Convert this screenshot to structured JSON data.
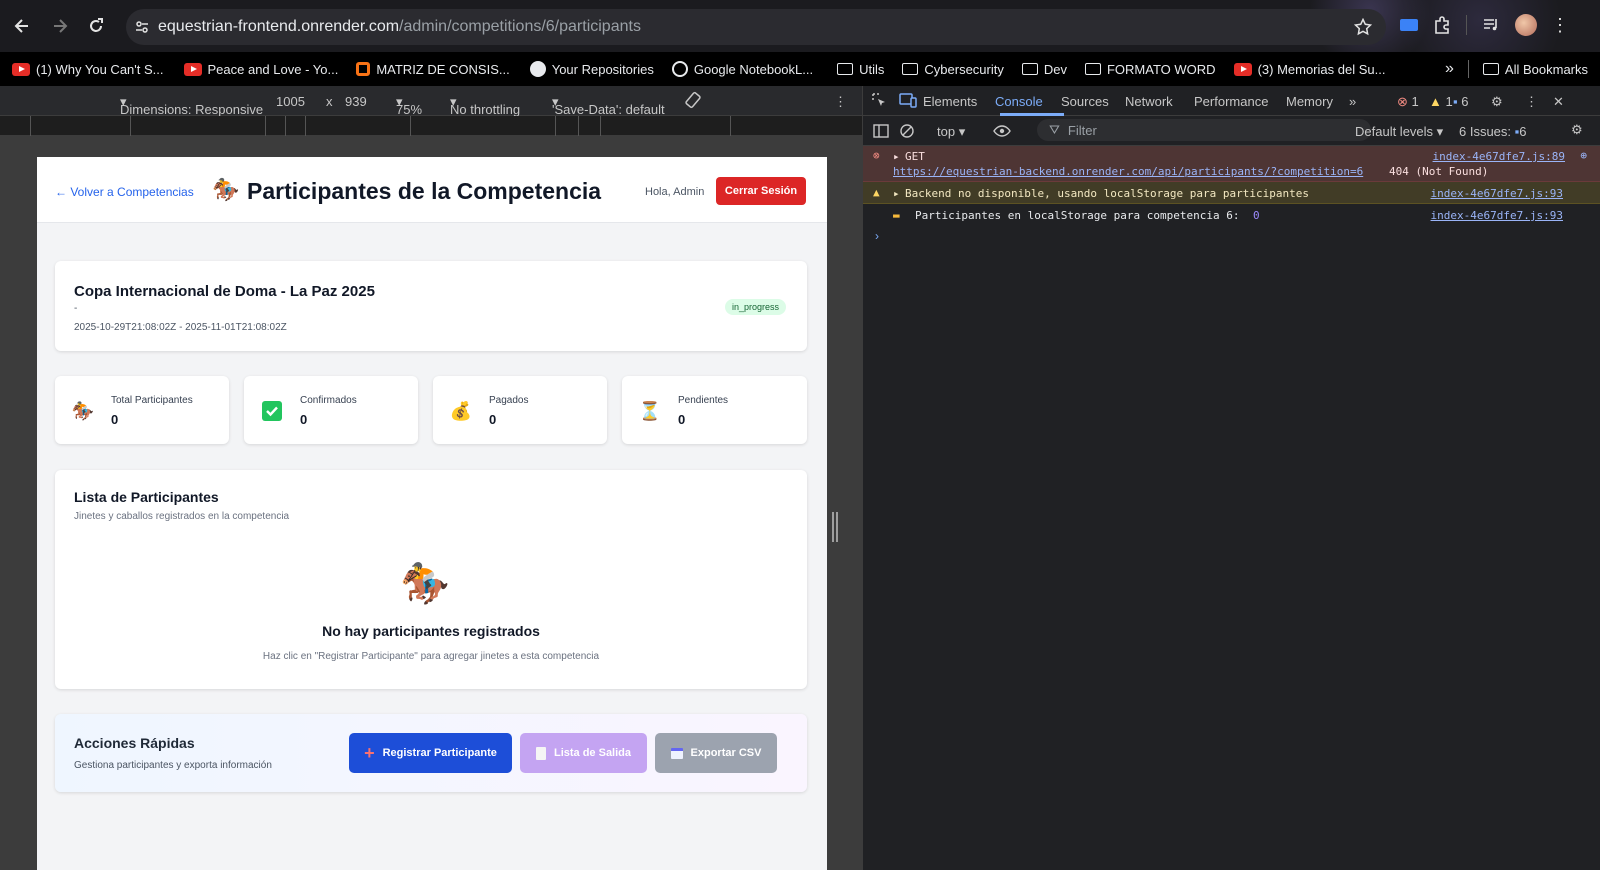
{
  "browser": {
    "url_host": "equestrian-frontend.onrender.com",
    "url_path": "/admin/competitions/6/participants",
    "bookmarks": [
      {
        "label": "(1) Why You Can't S...",
        "icon": "youtube-icon"
      },
      {
        "label": "Peace and Love - Yo...",
        "icon": "youtube-icon"
      },
      {
        "label": "MATRIZ DE CONSIS...",
        "icon": "app-icon"
      },
      {
        "label": "Your Repositories",
        "icon": "github-icon"
      },
      {
        "label": "Google NotebookL...",
        "icon": "notebooklm-icon"
      },
      {
        "label": "Utils",
        "icon": "folder-icon"
      },
      {
        "label": "Cybersecurity",
        "icon": "folder-icon"
      },
      {
        "label": "Dev",
        "icon": "folder-icon"
      },
      {
        "label": "FORMATO WORD",
        "icon": "folder-icon"
      },
      {
        "label": "(3) Memorias del Su...",
        "icon": "youtube-icon"
      }
    ],
    "all_bookmarks": "All Bookmarks"
  },
  "device_toolbar": {
    "dimensions": "Dimensions: Responsive",
    "width": "1005",
    "x": "x",
    "height": "939",
    "zoom": "75%",
    "throttling": "No throttling",
    "save_data": "'Save-Data': default"
  },
  "app": {
    "back_link": "← Volver a Competencias",
    "title": "Participantes de la Competencia",
    "greeting": "Hola, Admin",
    "logout": "Cerrar Sesión",
    "competition": {
      "name": "Copa Internacional de Doma - La Paz 2025",
      "location": "-",
      "dates": "2025-10-29T21:08:02Z - 2025-11-01T21:08:02Z",
      "status": "in_progress"
    },
    "stats": [
      {
        "label": "Total Participantes",
        "value": "0",
        "icon": "horse-racing-icon"
      },
      {
        "label": "Confirmados",
        "value": "0",
        "icon": "check-icon"
      },
      {
        "label": "Pagados",
        "value": "0",
        "icon": "money-bag-icon"
      },
      {
        "label": "Pendientes",
        "value": "0",
        "icon": "hourglass-icon"
      }
    ],
    "list": {
      "title": "Lista de Participantes",
      "subtitle": "Jinetes y caballos registrados en la competencia",
      "empty_title": "No hay participantes registrados",
      "empty_hint": "Haz clic en \"Registrar Participante\" para agregar jinetes a esta competencia"
    },
    "quick_actions": {
      "title": "Acciones Rápidas",
      "subtitle": "Gestiona participantes y exporta información",
      "register": "Registrar Participante",
      "start_list": "Lista de Salida",
      "export": "Exportar CSV"
    }
  },
  "devtools": {
    "tabs": [
      "Elements",
      "Console",
      "Sources",
      "Network",
      "Performance",
      "Memory"
    ],
    "active_tab": "Console",
    "error_count": "1",
    "warning_count": "1",
    "info_count": "6",
    "context": "top",
    "filter_placeholder": "Filter",
    "levels": "Default levels",
    "issues": "6 Issues:",
    "issues_count": "6",
    "logs": {
      "error_method": "GET",
      "error_url": "https://equestrian-backend.onrender.com/api/participants/?competition=6",
      "error_status": "404 (Not Found)",
      "error_source": "index-4e67dfe7.js:89",
      "warn_text": "Backend no disponible, usando localStorage para participantes",
      "warn_source": "index-4e67dfe7.js:93",
      "info_text": "Participantes en localStorage para competencia 6:",
      "info_value": "0",
      "info_source": "index-4e67dfe7.js:93"
    }
  },
  "colors": {
    "accent_red": "#dc2626",
    "accent_blue": "#1d4ed8",
    "status_green": "#dcfce7"
  }
}
